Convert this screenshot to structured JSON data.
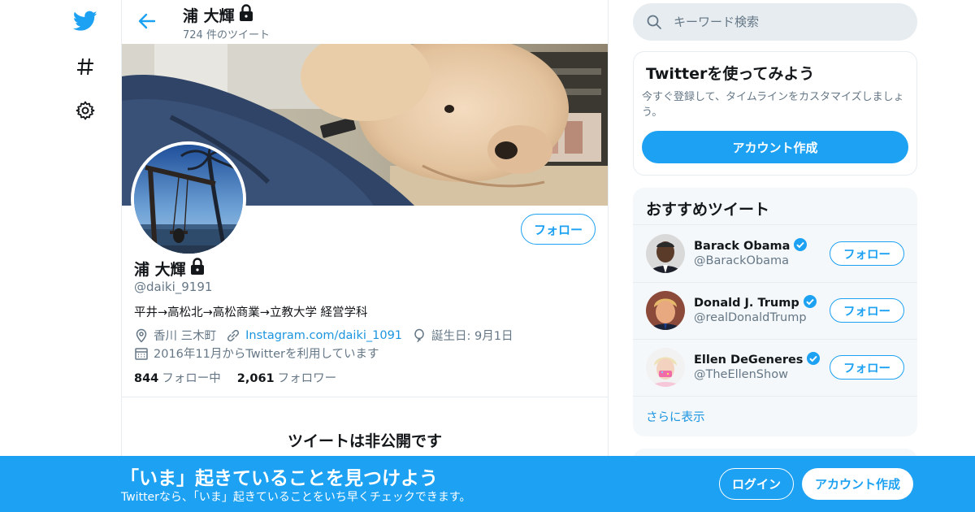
{
  "header": {
    "name": "浦 大輝",
    "tweet_count": "724 件のツイート"
  },
  "profile": {
    "name": "浦 大輝",
    "handle": "@daiki_9191",
    "bio": "平井→高松北→高松商業→立教大学 経営学科",
    "location": "香川 三木町",
    "website": "Instagram.com/daiki_1091",
    "birthday": "誕生日: 9月1日",
    "joined": "2016年11月からTwitterを利用しています",
    "following_count": "844",
    "following_label": "フォロー中",
    "followers_count": "2,061",
    "followers_label": "フォロワー",
    "follow_button": "フォロー",
    "private_notice": "ツイートは非公開です"
  },
  "search": {
    "placeholder": "キーワード検索"
  },
  "signup_card": {
    "title": "Twitterを使ってみよう",
    "description": "今すぐ登録して、タイムラインをカスタマイズしましょう。",
    "button": "アカウント作成"
  },
  "recommended": {
    "title": "おすすめツイート",
    "users": [
      {
        "name": "Barack Obama",
        "handle": "@BarackObama",
        "verified": true,
        "button": "フォロー"
      },
      {
        "name": "Donald J. Trump",
        "handle": "@realDonaldTrump",
        "verified": true,
        "button": "フォロー"
      },
      {
        "name": "Ellen DeGeneres",
        "handle": "@TheEllenShow",
        "verified": true,
        "button": "フォロー"
      }
    ],
    "show_more": "さらに表示"
  },
  "bottom_bar": {
    "headline": "「いま」起きていることを見つけよう",
    "subtext": "Twitterなら、「いま」起きていることをいち早くチェックできます。",
    "login": "ログイン",
    "signup": "アカウント作成"
  },
  "icons": [
    "twitter-bird-icon",
    "hashtag-icon",
    "gear-icon",
    "back-arrow-icon",
    "lock-icon",
    "location-icon",
    "link-icon",
    "balloon-icon",
    "calendar-icon",
    "search-icon",
    "verified-badge-icon"
  ],
  "colors": {
    "accent": "#1da1f2",
    "link": "#1b95e0",
    "secondary_text": "#657786",
    "border": "#e6ecf0",
    "panel": "#f5f8fa"
  }
}
